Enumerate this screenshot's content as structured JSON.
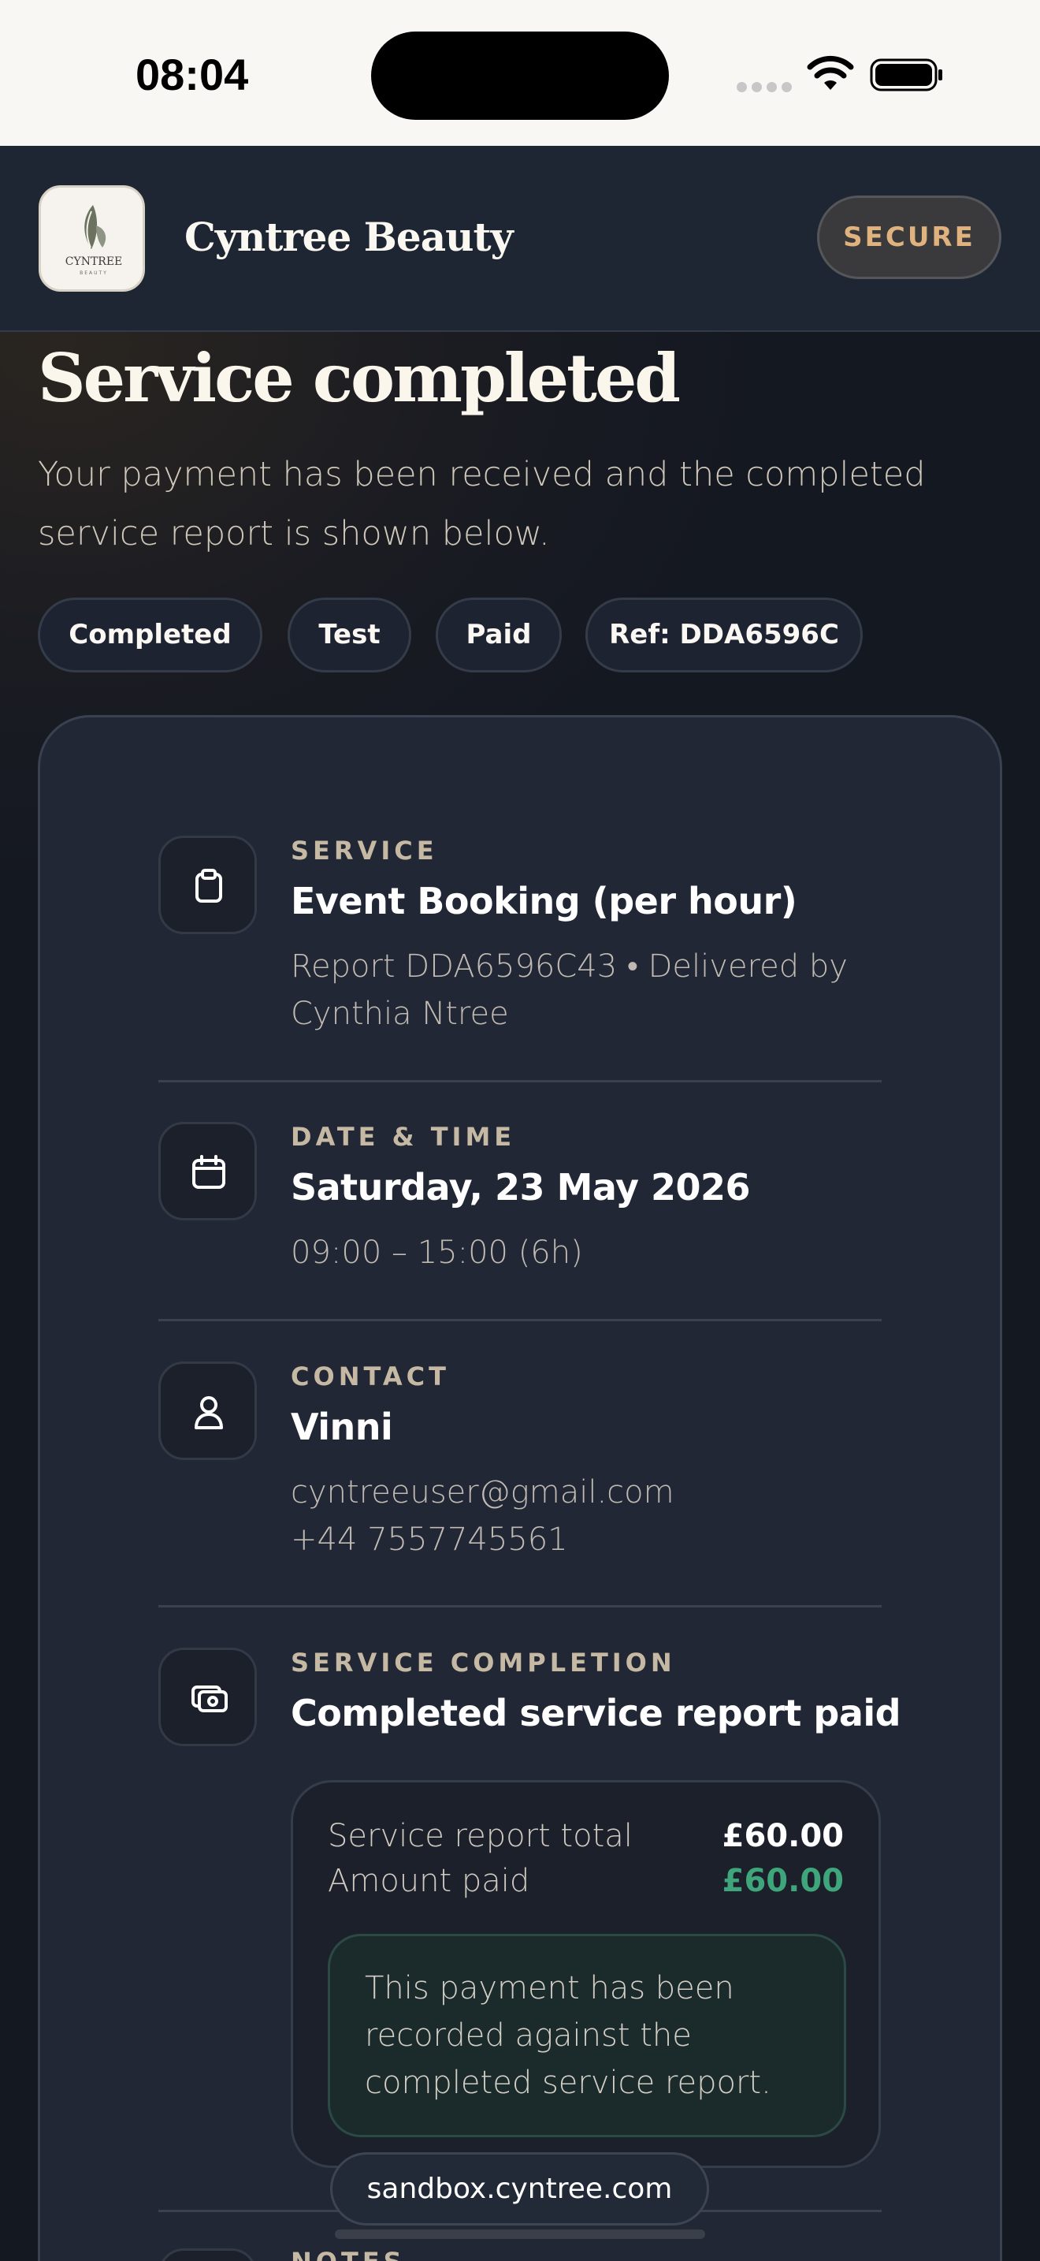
{
  "status_bar": {
    "time": "08:04"
  },
  "header": {
    "brand_name": "Cyntree Beauty",
    "logo_text": "CYNTREE",
    "logo_subtext": "BEAUTY",
    "secure_label": "SECURE"
  },
  "hero": {
    "title": "Service completed",
    "subtitle": "Your payment has been received and the completed service report is shown below."
  },
  "chips": [
    "Completed",
    "Test",
    "Paid",
    "Ref: DDA6596C"
  ],
  "sections": {
    "service": {
      "label": "SERVICE",
      "title": "Event Booking (per hour)",
      "detail": "Report DDA6596C43 • Delivered by Cynthia Ntree",
      "icon": "clipboard-icon"
    },
    "datetime": {
      "label": "DATE & TIME",
      "title": "Saturday, 23 May 2026",
      "detail": "09:00 – 15:00 (6h)",
      "icon": "calendar-icon"
    },
    "contact": {
      "label": "CONTACT",
      "title": "Vinni",
      "email": "cyntreeuser@gmail.com",
      "phone": "+44 7557745561",
      "icon": "user-icon"
    },
    "completion": {
      "label": "SERVICE COMPLETION",
      "title": "Completed service report paid",
      "icon": "cash-icon",
      "total_label": "Service report total",
      "total_value": "£60.00",
      "paid_label": "Amount paid",
      "paid_value": "£60.00",
      "note": "This payment has been recorded against the completed service report."
    },
    "notes": {
      "label": "NOTES"
    }
  },
  "browser": {
    "url": "sandbox.cyntree.com"
  },
  "colors": {
    "accent_gold": "#e0b27d",
    "paid_green": "#3fa57a",
    "card_bg": "#212735",
    "header_bg": "#1f2633"
  }
}
